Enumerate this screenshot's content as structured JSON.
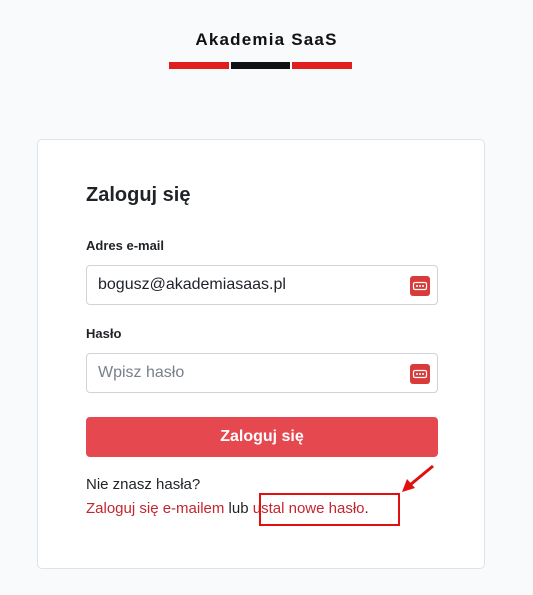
{
  "brand": {
    "name": "Akademia SaaS",
    "colors": {
      "red": "#e11d1d",
      "black": "#111111"
    }
  },
  "login": {
    "title": "Zaloguj się",
    "email_label": "Adres e-mail",
    "email_value": "bogusz@akademiasaas.pl",
    "password_label": "Hasło",
    "password_placeholder": "Wpisz hasło",
    "password_manager_icon": "password-manager-icon",
    "submit_label": "Zaloguj się",
    "accent_color": "#e64850"
  },
  "help": {
    "question": "Nie znasz hasła?",
    "email_login_link": "Zaloguj się e-mailem",
    "or_text": " lub ",
    "reset_link": "ustal nowe hasło",
    "end_punct": "."
  },
  "annotation": {
    "color": "#e01010",
    "icon": "arrow-icon"
  }
}
